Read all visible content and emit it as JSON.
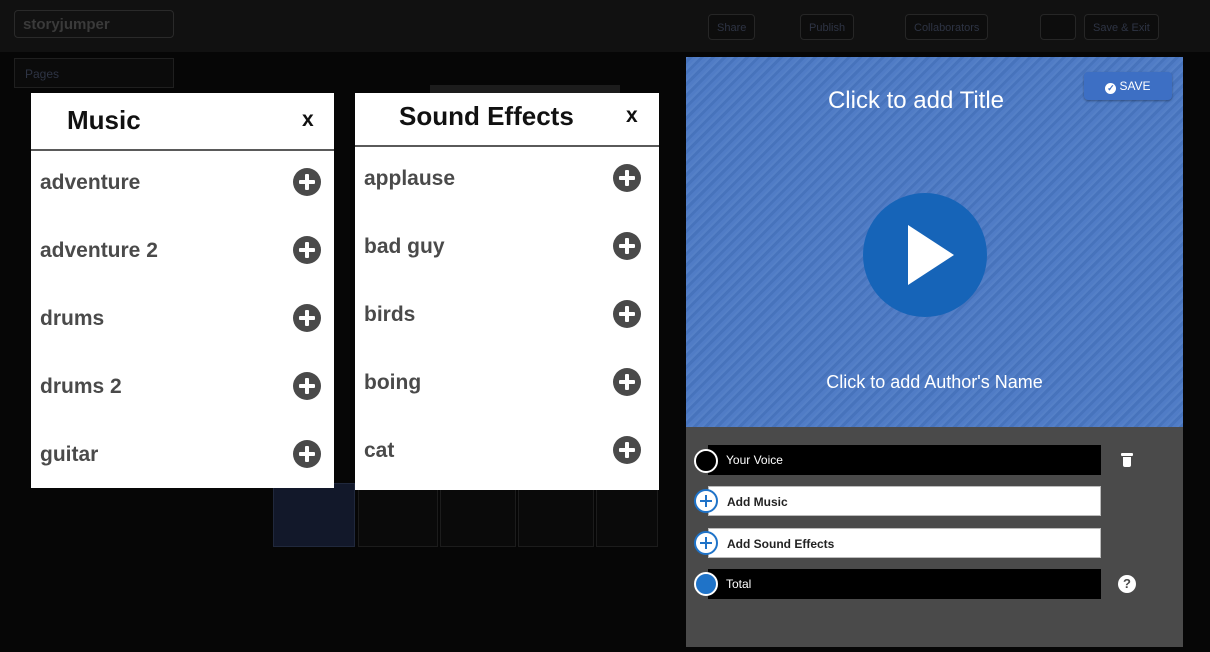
{
  "app": {
    "logo": "storyjumper"
  },
  "toolbar": {
    "share": "Share",
    "publish": "Publish",
    "collaborators": "Collaborators",
    "save_exit": "Save & Exit"
  },
  "pages_menu": {
    "label": "Pages"
  },
  "music_panel": {
    "title": "Music",
    "close": "x",
    "items": [
      {
        "label": "adventure"
      },
      {
        "label": "adventure 2"
      },
      {
        "label": "drums"
      },
      {
        "label": "drums 2"
      },
      {
        "label": "guitar"
      }
    ]
  },
  "sfx_panel": {
    "title": "Sound Effects",
    "close": "x",
    "items": [
      {
        "label": "applause"
      },
      {
        "label": "bad guy"
      },
      {
        "label": "birds"
      },
      {
        "label": "boing"
      },
      {
        "label": "cat"
      }
    ]
  },
  "editor": {
    "save_label": "SAVE",
    "title_placeholder": "Click to add Title",
    "author_placeholder": "Click to add Author's Name",
    "tracks": {
      "voice": "Your Voice",
      "music": "Add Music",
      "sfx": "Add Sound Effects",
      "total": "Total"
    },
    "help_symbol": "?"
  },
  "colors": {
    "cover_blue": "#4a78c4",
    "play_blue": "#1664b8",
    "editor_gray": "#4a4a4a"
  }
}
